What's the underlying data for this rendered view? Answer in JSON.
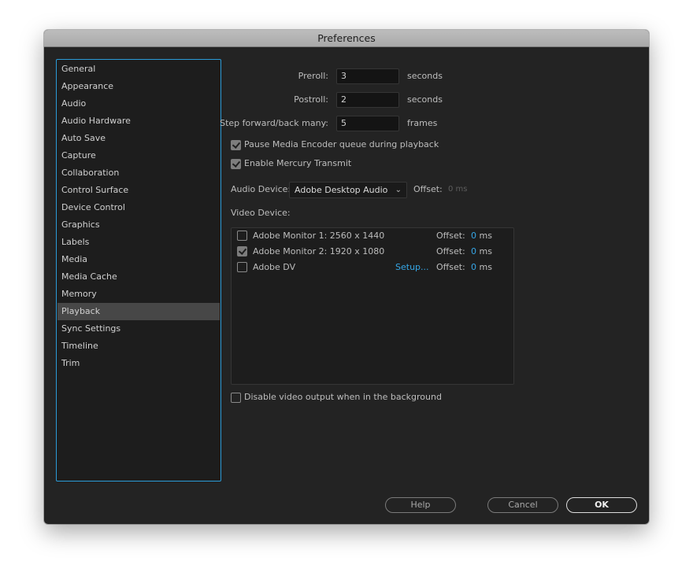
{
  "window": {
    "title": "Preferences"
  },
  "sidebar": {
    "items": [
      {
        "label": "General"
      },
      {
        "label": "Appearance"
      },
      {
        "label": "Audio"
      },
      {
        "label": "Audio Hardware"
      },
      {
        "label": "Auto Save"
      },
      {
        "label": "Capture"
      },
      {
        "label": "Collaboration"
      },
      {
        "label": "Control Surface"
      },
      {
        "label": "Device Control"
      },
      {
        "label": "Graphics"
      },
      {
        "label": "Labels"
      },
      {
        "label": "Media"
      },
      {
        "label": "Media Cache"
      },
      {
        "label": "Memory"
      },
      {
        "label": "Playback"
      },
      {
        "label": "Sync Settings"
      },
      {
        "label": "Timeline"
      },
      {
        "label": "Trim"
      }
    ],
    "selected": "Playback"
  },
  "playback": {
    "preroll": {
      "label": "Preroll:",
      "value": "3",
      "unit": "seconds"
    },
    "postroll": {
      "label": "Postroll:",
      "value": "2",
      "unit": "seconds"
    },
    "step": {
      "label": "Step forward/back many:",
      "value": "5",
      "unit": "frames"
    },
    "pause_encoder": {
      "label": "Pause Media Encoder queue during playback",
      "checked": true
    },
    "mercury_transmit": {
      "label": "Enable Mercury Transmit",
      "checked": true
    },
    "audio_device": {
      "label": "Audio Device:",
      "selected": "Adobe Desktop Audio",
      "offset_label": "Offset:",
      "offset_value": "0 ms"
    },
    "video_device": {
      "label": "Video Device:",
      "devices": [
        {
          "name": "Adobe Monitor 1: 2560 x 1440",
          "checked": false,
          "setup": "",
          "offset_label": "Offset:",
          "offset_num": "0",
          "offset_unit": "ms"
        },
        {
          "name": "Adobe Monitor 2: 1920 x 1080",
          "checked": true,
          "setup": "",
          "offset_label": "Offset:",
          "offset_num": "0",
          "offset_unit": "ms"
        },
        {
          "name": "Adobe DV",
          "checked": false,
          "setup": "Setup...",
          "offset_label": "Offset:",
          "offset_num": "0",
          "offset_unit": "ms"
        }
      ]
    },
    "disable_bg_output": {
      "label": "Disable video output when in the background",
      "checked": false
    }
  },
  "buttons": {
    "help": "Help",
    "cancel": "Cancel",
    "ok": "OK"
  },
  "colors": {
    "accent": "#2b9bd8",
    "link": "#35a6e6",
    "background": "#232323",
    "selected_item": "#474747"
  }
}
